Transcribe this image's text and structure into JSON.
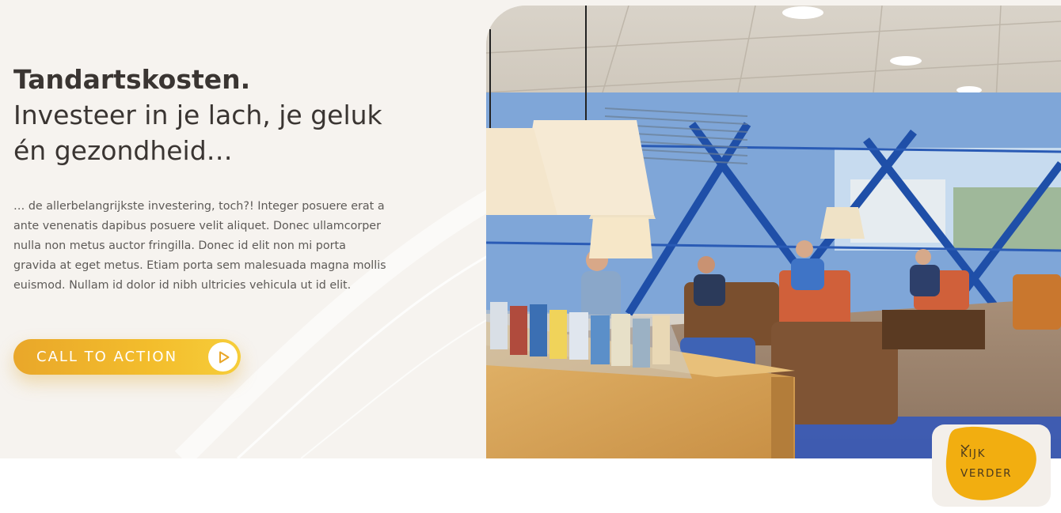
{
  "hero": {
    "headline_bold": "Tandartskosten.",
    "headline_sub": "Investeer in je lach, je geluk én gezondheid…",
    "body": "… de allerbelangrijkste investering, toch?! Integer posuere erat a ante venenatis dapibus posuere velit aliquet. Donec ullamcorper nulla non metus auctor fringilla. Donec id elit non mi porta gravida at eget metus. Etiam porta sem malesuada magna mollis euismod. Nullam id dolor id nibh ultricies vehicula ut id elit.",
    "cta": {
      "label": "CALL TO ACTION",
      "icon": "play-circle-icon"
    }
  },
  "photo": {
    "icon": "waiting-room-photo"
  },
  "scroll_hint": {
    "line1": "KIJK",
    "line2": "VERDER",
    "icon": "chevron-down-icon"
  },
  "colors": {
    "accent": "#f3bd2c",
    "accent_dark": "#e9a72a",
    "background": "#f6f3ef",
    "text": "#3a3532",
    "bar": "#f6cf80"
  }
}
